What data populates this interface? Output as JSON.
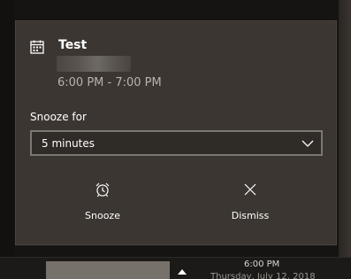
{
  "toast": {
    "icon": "calendar-icon",
    "title": "Test",
    "time_range": "6:00 PM - 7:00 PM",
    "snooze_label": "Snooze for",
    "snooze_select": {
      "selected": "5 minutes",
      "icon": "chevron-down-icon"
    },
    "actions": {
      "snooze": {
        "label": "Snooze",
        "icon": "alarm-clock-icon"
      },
      "dismiss": {
        "label": "Dismiss",
        "icon": "close-icon"
      }
    }
  },
  "taskbar": {
    "time": "6:00 PM",
    "date": "Thursday, July 12, 2018",
    "overflow_icon": "chevron-up-icon"
  },
  "colors": {
    "toast_bg": "#3b3631",
    "select_border": "#7b7772",
    "secondary_text": "#b8b3ad",
    "taskbar_bg": "#1c1a18"
  }
}
